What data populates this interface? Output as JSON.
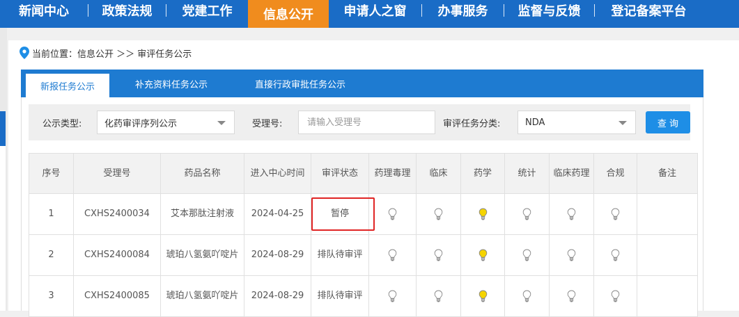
{
  "topnav": {
    "items": [
      {
        "label": "新闻中心"
      },
      {
        "label": "政策法规"
      },
      {
        "label": "党建工作"
      },
      {
        "label": "信息公开"
      },
      {
        "label": "申请人之窗"
      },
      {
        "label": "办事服务"
      },
      {
        "label": "监督与反馈"
      },
      {
        "label": "登记备案平台"
      }
    ],
    "active_index": 3,
    "bar_color": "#1a6cc6",
    "active_color": "#f08c1e"
  },
  "breadcrumb": {
    "icon": "location-pin-icon",
    "text": "当前位置：信息公开 ＞＞ 审评任务公示"
  },
  "tabs": [
    {
      "label": "新报任务公示",
      "active": true
    },
    {
      "label": "补充资料任务公示",
      "active": false
    },
    {
      "label": "直接行政审批任务公示",
      "active": false
    }
  ],
  "filter": {
    "type_label": "公示类型:",
    "type_value": "化药审评序列公示",
    "accept_label": "受理号:",
    "accept_placeholder": "请输入受理号",
    "category_label": "审评任务分类:",
    "category_value": "NDA",
    "query_label": "查 询"
  },
  "table": {
    "headers": [
      "序号",
      "受理号",
      "药品名称",
      "进入中心时间",
      "审评状态",
      "药理毒理",
      "临床",
      "药学",
      "统计",
      "临床药理",
      "合规",
      "备注"
    ],
    "rows": [
      {
        "no": "1",
        "accept_no": "CXHS2400034",
        "drug": "艾本那肽注射液",
        "date": "2024-04-25",
        "status": "暂停",
        "bulbs": [
          "off",
          "off",
          "on",
          "off",
          "off",
          "off"
        ],
        "remark": ""
      },
      {
        "no": "2",
        "accept_no": "CXHS2400084",
        "drug": "琥珀八氢氨吖啶片",
        "date": "2024-08-29",
        "status": "排队待审评",
        "bulbs": [
          "off",
          "off",
          "on",
          "off",
          "off",
          "off"
        ],
        "remark": ""
      },
      {
        "no": "3",
        "accept_no": "CXHS2400085",
        "drug": "琥珀八氢氨吖啶片",
        "date": "2024-08-29",
        "status": "排队待审评",
        "bulbs": [
          "off",
          "off",
          "on",
          "off",
          "off",
          "off"
        ],
        "remark": ""
      }
    ]
  },
  "colors": {
    "tab_bar": "#1e7bd1",
    "query_button": "#1e8ee6",
    "highlight_box": "#e02424",
    "bulb_on": "#f5d400",
    "bulb_off": "#ffffff"
  }
}
